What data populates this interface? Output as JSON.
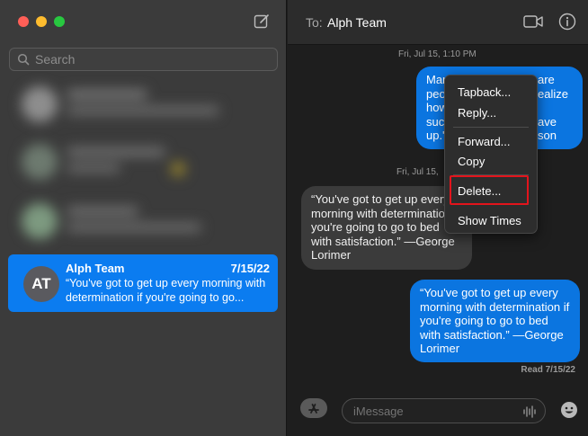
{
  "sidebar": {
    "search_placeholder": "Search",
    "selected_conversation": {
      "initials": "AT",
      "name": "Alph Team",
      "date": "7/15/22",
      "preview": "“You've got to get up every morning with determination if you're going to go..."
    }
  },
  "header": {
    "to_label": "To:",
    "recipient": "Alph Team"
  },
  "messages": {
    "timestamp1": "Fri, Jul 15, 1:10 PM",
    "timestamp2": "Fri, Jul 15, ",
    "bubble1_lines": [
      "Man",
      "peo",
      "how",
      "succ",
      "up.\""
    ],
    "bubble1_right": [
      "are",
      "ealize",
      "",
      "ave",
      "son"
    ],
    "bubble2": "“You've got to get up every morning with determination if you're going to go to bed with satisfaction.” —George Lorimer",
    "bubble3": "“You've got to get up every morning with determination if you're going to go to bed with satisfaction.” —George Lorimer",
    "read_receipt": "Read 7/15/22"
  },
  "input": {
    "placeholder": "iMessage"
  },
  "context_menu": {
    "tapback": "Tapback...",
    "reply": "Reply...",
    "forward": "Forward...",
    "copy": "Copy",
    "delete": "Delete...",
    "show_times": "Show Times"
  },
  "colors": {
    "accent": "#0b7cf0",
    "highlight": "#e3141c"
  }
}
